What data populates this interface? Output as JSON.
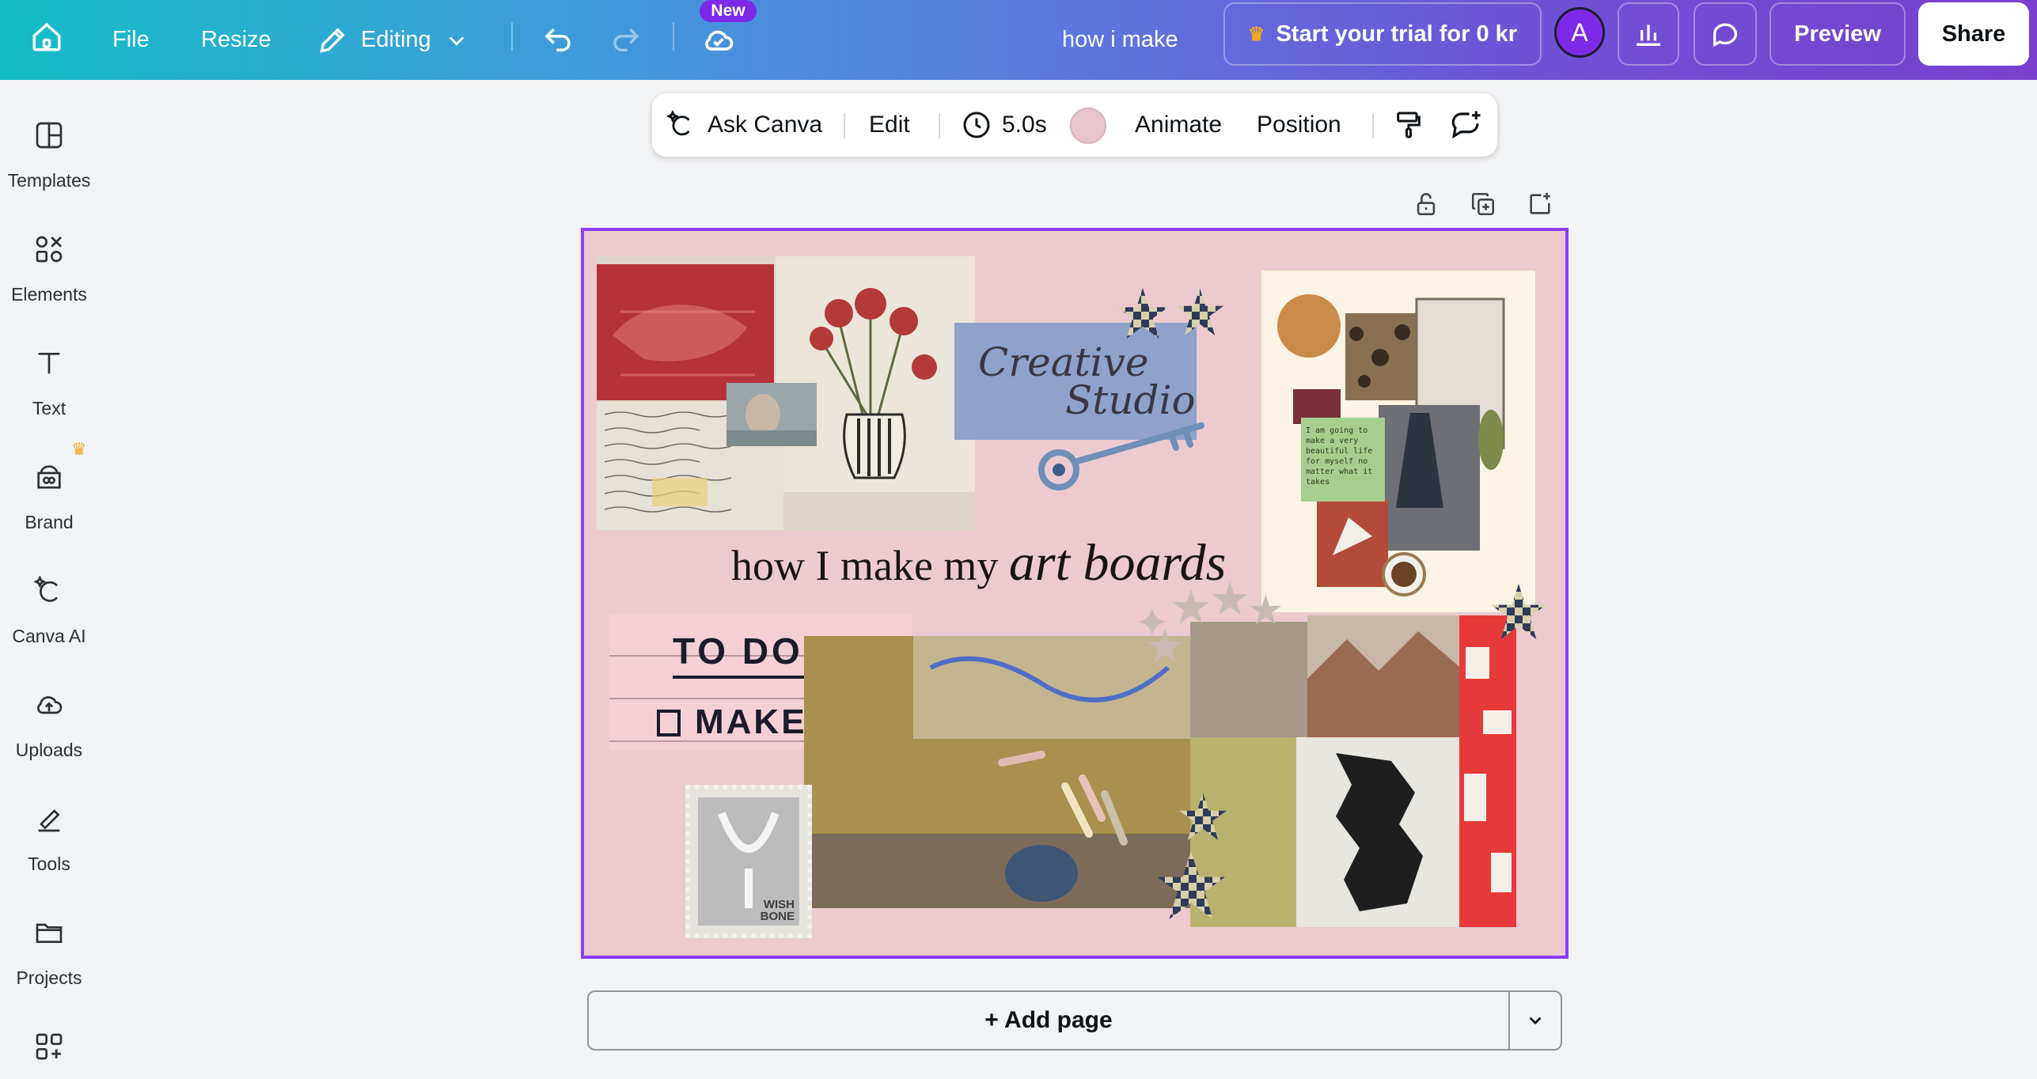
{
  "topbar": {
    "file_label": "File",
    "resize_label": "Resize",
    "editing_label": "Editing",
    "new_badge": "New",
    "doc_title": "how i make",
    "trial_label": "Start your trial for 0 kr",
    "avatar_initial": "A",
    "preview_label": "Preview",
    "share_label": "Share"
  },
  "sidebar": {
    "items": [
      {
        "label": "Templates",
        "icon": "templates-icon"
      },
      {
        "label": "Elements",
        "icon": "elements-icon"
      },
      {
        "label": "Text",
        "icon": "text-icon"
      },
      {
        "label": "Brand",
        "icon": "brand-icon"
      },
      {
        "label": "Canva AI",
        "icon": "canva-ai-icon"
      },
      {
        "label": "Uploads",
        "icon": "uploads-icon"
      },
      {
        "label": "Tools",
        "icon": "tools-icon"
      },
      {
        "label": "Projects",
        "icon": "projects-icon"
      },
      {
        "label": "",
        "icon": "apps-icon"
      }
    ]
  },
  "context_toolbar": {
    "ask_label": "Ask Canva",
    "edit_label": "Edit",
    "duration": "5.0s",
    "swatch_color": "#e8c5cc",
    "animate_label": "Animate",
    "position_label": "Position"
  },
  "canvas": {
    "background": "#eccad0",
    "headline_plain": "how I make my ",
    "headline_italic": "art boards",
    "studio_line1": "Creative",
    "studio_line2": "Studio",
    "todo_title": "TO DO:",
    "todo_item": "MAKE ART",
    "note_text": "I am going to make a very beautiful life for myself no matter what it takes",
    "stamp_line1": "WISH",
    "stamp_line2": "BONE"
  },
  "footer": {
    "add_page_label": "+ Add page"
  },
  "colors": {
    "accent": "#8b3dff",
    "gradient_start": "#14bdc7",
    "gradient_end": "#7a3fce"
  }
}
